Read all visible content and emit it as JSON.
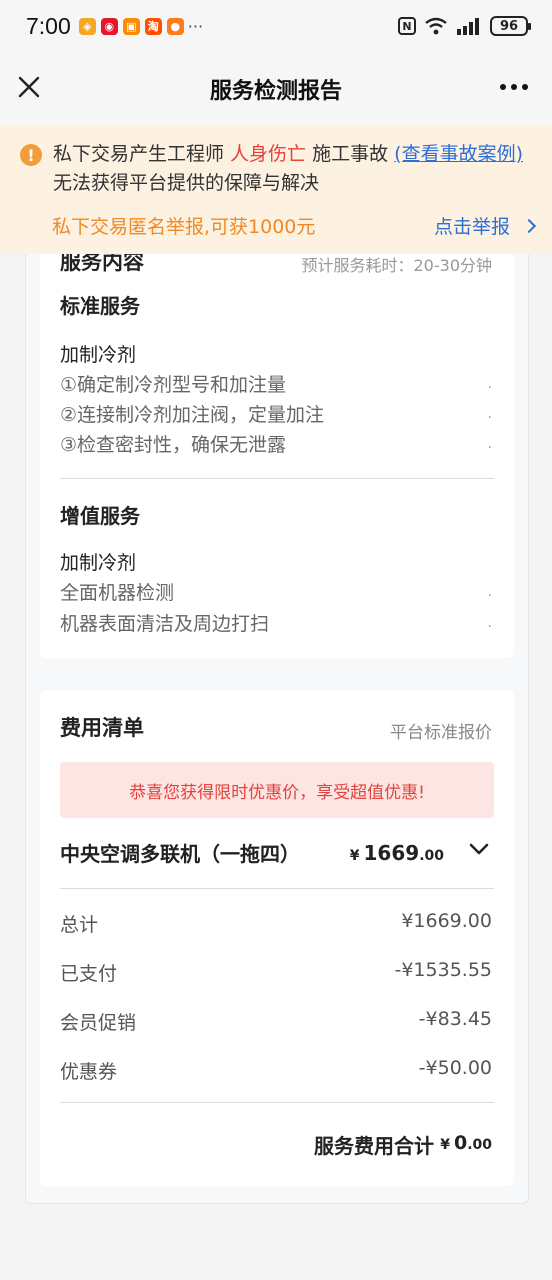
{
  "status_bar": {
    "time": "7:00",
    "apps": [
      {
        "icon": "wallet-app-icon",
        "glyph": "◈",
        "color": "#f5a623"
      },
      {
        "icon": "weibo-app-icon",
        "glyph": "◉",
        "color": "#e6162d"
      },
      {
        "icon": "orange-app-icon",
        "glyph": "▣",
        "color": "#ff8a00"
      },
      {
        "icon": "taobao-app-icon",
        "glyph": "淘",
        "color": "#ff5000"
      },
      {
        "icon": "message-app-icon",
        "glyph": "●",
        "color": "#ff7a18"
      }
    ],
    "more": "···",
    "nfc": "N",
    "battery": "96"
  },
  "nav": {
    "title": "服务检测报告"
  },
  "warning": {
    "text_before": "私下交易产生工程师 ",
    "injury": "人身伤亡",
    "text_mid": " 施工事故 ",
    "link": "(查看事故案例)",
    "text_after": " 无法获得平台提供的保障与解决",
    "reward": "私下交易匿名举报,可获1000元",
    "report": "点击举报",
    "accent": "#f08a24"
  },
  "service": {
    "title": "服务内容",
    "duration_note": "预计服务耗时：20-30分钟",
    "standard": {
      "title": "标准服务",
      "item_name": "加制冷剂",
      "steps": [
        "①确定制冷剂型号和加注量",
        "②连接制冷剂加注阀，定量加注",
        "③检查密封性，确保无泄露"
      ]
    },
    "value_added": {
      "title": "增值服务",
      "item_name": "加制冷剂",
      "items": [
        "全面机器检测",
        "机器表面清洁及周边打扫"
      ]
    },
    "dot": "."
  },
  "fee": {
    "title": "费用清单",
    "note": "平台标准报价",
    "promo": "恭喜您获得限时优惠价，享受超值优惠!",
    "product": "中央空调多联机（一拖四）",
    "product_price": {
      "currency": "¥",
      "int": "1669",
      "dec": ".00"
    },
    "rows": [
      {
        "label": "总计",
        "value": "¥1669.00"
      },
      {
        "label": "已支付",
        "value": "-¥1535.55"
      },
      {
        "label": "会员促销",
        "value": "-¥83.45"
      },
      {
        "label": "优惠券",
        "value": "-¥50.00"
      }
    ],
    "total_label": "服务费用合计",
    "total": {
      "currency": "¥",
      "int": "0",
      "dec": ".00"
    },
    "promo_color": "#e2443d"
  }
}
